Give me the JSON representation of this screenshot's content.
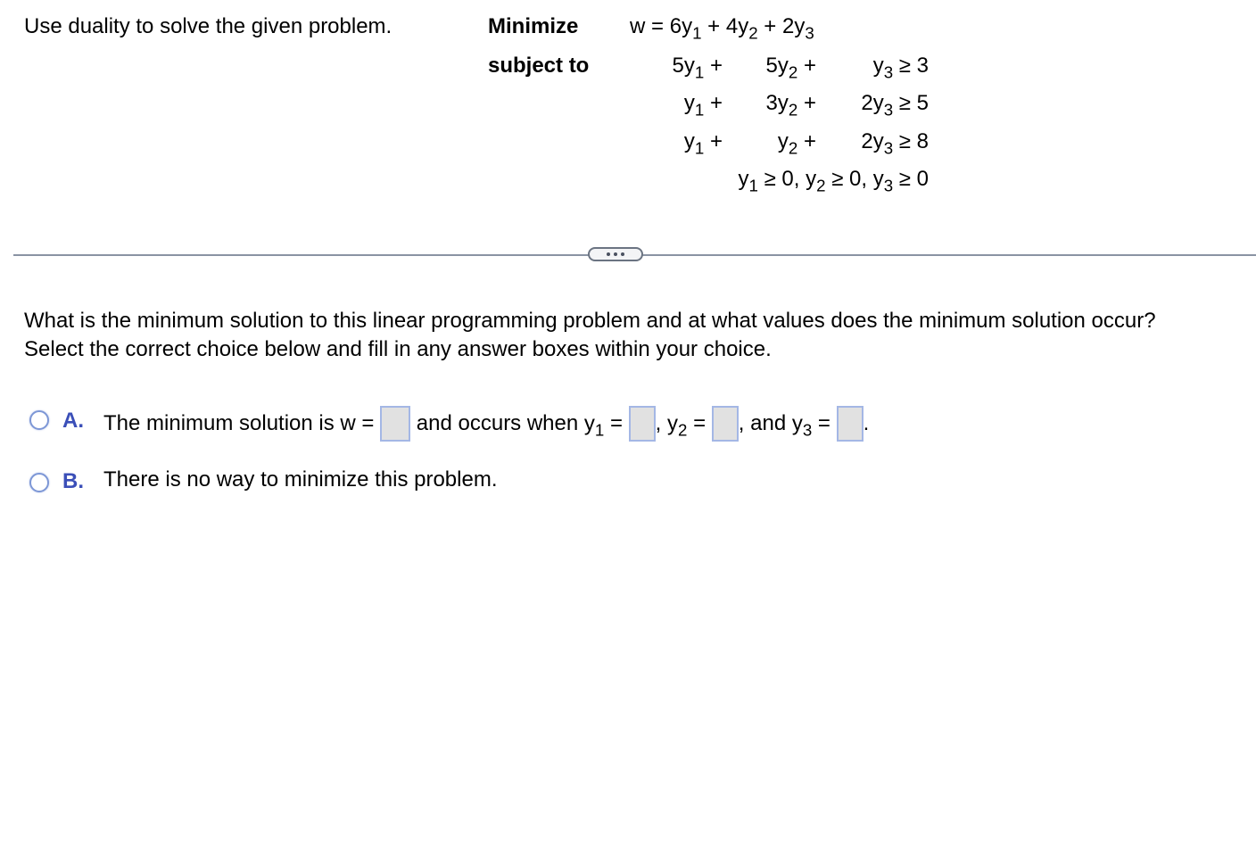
{
  "instruction": "Use duality to solve the given problem.",
  "problem": {
    "objective_label": "Minimize",
    "constraints_label": "subject to",
    "objective": {
      "lhs": "w",
      "terms": [
        {
          "coef": "6",
          "var": "y",
          "sub": "1"
        },
        {
          "coef": "4",
          "var": "y",
          "sub": "2"
        },
        {
          "coef": "2",
          "var": "y",
          "sub": "3"
        }
      ]
    },
    "constraints": [
      {
        "c1": "5",
        "c2": "5",
        "c3": "",
        "rhs": "3"
      },
      {
        "c1": "",
        "c2": "3",
        "c3": "2",
        "rhs": "5"
      },
      {
        "c1": "",
        "c2": "",
        "c3": "2",
        "rhs": "8"
      }
    ],
    "nonnegativity": "y1 ≥ 0, y2 ≥ 0, y3 ≥ 0"
  },
  "more_button": {
    "icon": "ellipsis-icon"
  },
  "question": {
    "line1": "What is the minimum solution to this linear programming problem and at what values does the minimum solution occur?",
    "line2": "Select the correct choice below and fill in any answer boxes within your choice."
  },
  "choices": [
    {
      "letter": "A.",
      "text_before_w": "The minimum solution is w =",
      "text_occurs": "and occurs when",
      "y1_label": "y",
      "y1_sub": "1",
      "eq": "=",
      "y2_prefix": ",",
      "y2_label": "y",
      "y2_sub": "2",
      "y3_prefix": ", and",
      "y3_label": "y",
      "y3_sub": "3",
      "period": ".",
      "answers": {
        "w": "",
        "y1": "",
        "y2": "",
        "y3": ""
      },
      "selected": false
    },
    {
      "letter": "B.",
      "text": "There is no way to minimize this problem.",
      "selected": false
    }
  ]
}
